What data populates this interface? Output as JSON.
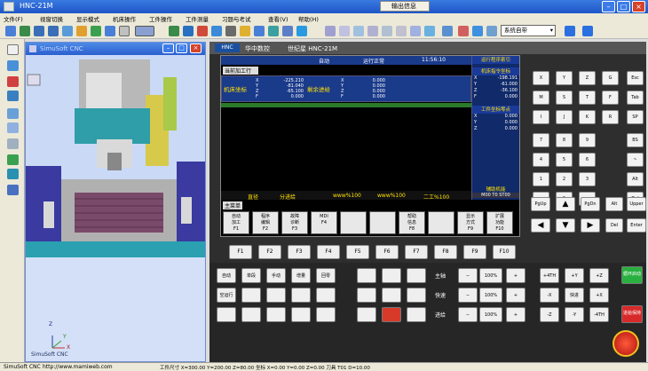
{
  "window": {
    "title": "HNC-21M",
    "middle_tab": "输出信息"
  },
  "menu": [
    "文件(F)",
    "视窗切换",
    "显示模式",
    "机床操作",
    "工件操作",
    "工件测量",
    "习题与考试",
    "查看(V)",
    "帮助(H)"
  ],
  "toolbar": {
    "coordinate_select": "系统自带"
  },
  "sim_window": {
    "title": "SimuSoft CNC",
    "axis_x": "X",
    "axis_y": "Y",
    "axis_z": "Z",
    "brand": "SimuSoft CNC"
  },
  "cnc": {
    "brand": "华中数控",
    "system": "世纪星 HNC-21M",
    "status": {
      "mode": "自动",
      "run": "运行正常",
      "time": "11:56:10"
    },
    "program_tab": "当前加工行",
    "coords": {
      "machine_label": "机床坐标",
      "remaining_label": "剩余进给",
      "machine": [
        [
          "X",
          "-225.210"
        ],
        [
          "Y",
          "-81.040"
        ],
        [
          "Z",
          "-65.100"
        ],
        [
          "F",
          "0.000"
        ]
      ],
      "remaining": [
        [
          "X",
          "0.000"
        ],
        [
          "Y",
          "0.000"
        ],
        [
          "Z",
          "0.000"
        ],
        [
          "F",
          "0.000"
        ]
      ]
    },
    "right_panel": {
      "title": "运行程序索引",
      "machine_title": "机床指令坐标",
      "values": [
        [
          "X",
          "-198.191"
        ],
        [
          "Y",
          "-61.000"
        ],
        [
          "Z",
          "-36.100"
        ],
        [
          "F",
          "0.000"
        ]
      ],
      "offset_title": "工件坐标零点",
      "offsets": [
        [
          "X",
          "0.000"
        ],
        [
          "Y",
          "0.000"
        ],
        [
          "Z",
          "0.000"
        ]
      ],
      "aux_title": "辅助机能",
      "aux": "M00 T0 ST00"
    },
    "bottom_status": [
      "直径",
      "分进给",
      "www%100",
      "www%100",
      "二工%100"
    ],
    "menu_label": "主菜单",
    "softkeys": [
      {
        "l1": "自动",
        "l2": "加工",
        "f": "F1"
      },
      {
        "l1": "程序",
        "l2": "编辑",
        "f": "F2"
      },
      {
        "l1": "故障",
        "l2": "诊断",
        "f": "F3"
      },
      {
        "l1": "MDI",
        "l2": "",
        "f": "F4"
      },
      {
        "l1": "",
        "l2": "",
        "f": ""
      },
      {
        "l1": "",
        "l2": "",
        "f": ""
      },
      {
        "l1": "帮助",
        "l2": "信息",
        "f": "F8"
      },
      {
        "l1": "",
        "l2": "",
        "f": ""
      },
      {
        "l1": "显示",
        "l2": "方式",
        "f": "F9"
      },
      {
        "l1": "扩展",
        "l2": "功能",
        "f": "F10"
      }
    ],
    "fkeys": [
      "F1",
      "F2",
      "F3",
      "F4",
      "F5",
      "F6",
      "F7",
      "F8",
      "F9",
      "F10"
    ],
    "keypad": [
      [
        "X",
        "Y",
        "Z",
        "G",
        "Esc"
      ],
      [
        "M",
        "S",
        "T",
        "F",
        "Tab"
      ],
      [
        "I",
        "J",
        "K",
        "R",
        "SP"
      ],
      [
        "7",
        "8",
        "9",
        "",
        "BS"
      ],
      [
        "4",
        "5",
        "6",
        "",
        "~"
      ],
      [
        "1",
        "2",
        "3",
        "",
        "Alt"
      ],
      [
        "-",
        "0",
        ".",
        "",
        "Del"
      ]
    ],
    "nav": {
      "pgup": "PgUp",
      "pgdn": "PgDn",
      "alt": "Alt",
      "upper": "Upper",
      "del": "Del",
      "enter": "Enter"
    },
    "mode_keys": [
      "自动",
      "单段",
      "手动",
      "增量",
      "回零"
    ],
    "mode_row2": [
      "空运行",
      "",
      "",
      "",
      ""
    ],
    "overrides": [
      "主轴",
      "快速",
      "进给"
    ],
    "override_vals": [
      "100%",
      "100%",
      "100%"
    ],
    "axis_keys": [
      "+4TH",
      "+Y",
      "+Z",
      "-X",
      "快进",
      "+X",
      "-Z",
      "-Y",
      "-4TH"
    ],
    "cycle_start": "循环启动",
    "cycle_stop": "进给保持"
  },
  "status_bar": {
    "left": "SimuSoft CNC",
    "url": "http://www.mamiweb.com",
    "info": "工件尺寸 X=300.00 Y=200.00 Z=80.00 坐标 X=0.00 Y=0.00 Z=0.00 刀具 T01 D=10.00"
  }
}
